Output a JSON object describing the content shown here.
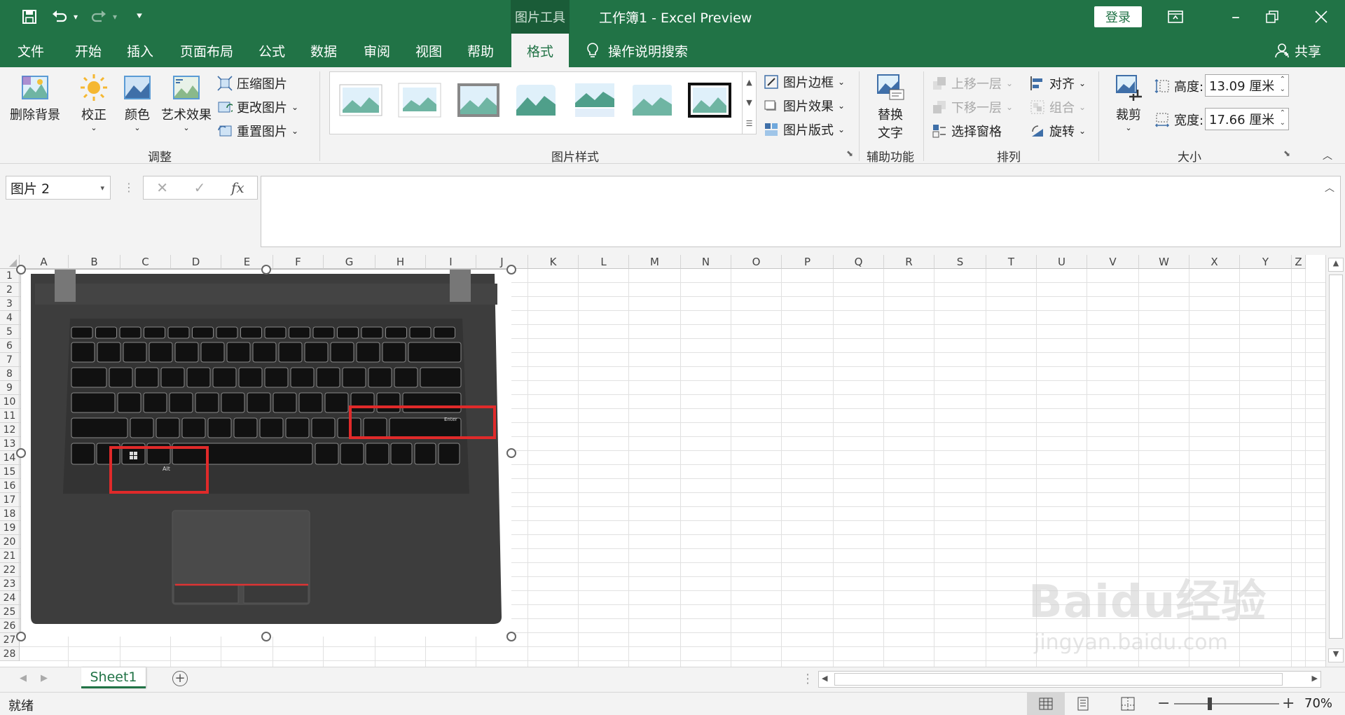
{
  "titlebar": {
    "context_label": "图片工具",
    "doc_title": "工作簿1  -  Excel Preview",
    "login": "登录",
    "minimize_icon": "ribbon-display-icon",
    "restore_icon": "restore-icon",
    "close_icon": "close-icon"
  },
  "tabs": [
    "文件",
    "开始",
    "插入",
    "页面布局",
    "公式",
    "数据",
    "审阅",
    "视图",
    "帮助",
    "格式"
  ],
  "active_tab": "格式",
  "tellme": "操作说明搜索",
  "share": "共享",
  "ribbon": {
    "adjust": {
      "remove_bg": "删除背景",
      "corrections": "校正",
      "color": "颜色",
      "artistic": "艺术效果",
      "compress": "压缩图片",
      "change": "更改图片",
      "reset": "重置图片",
      "label": "调整"
    },
    "styles": {
      "label": "图片样式",
      "border": "图片边框",
      "effects": "图片效果",
      "layout": "图片版式"
    },
    "accessibility": {
      "alt_text_line1": "替换",
      "alt_text_line2": "文字",
      "label": "辅助功能"
    },
    "arrange": {
      "bring_forward": "上移一层",
      "send_backward": "下移一层",
      "selection_pane": "选择窗格",
      "align": "对齐",
      "group": "组合",
      "rotate": "旋转",
      "label": "排列"
    },
    "size": {
      "crop": "裁剪",
      "height_label": "高度:",
      "height_value": "13.09 厘米",
      "width_label": "宽度:",
      "width_value": "17.66 厘米",
      "label": "大小"
    }
  },
  "formula_bar": {
    "name_box": "图片 2",
    "fx": "fx",
    "content": ""
  },
  "columns": [
    "A",
    "B",
    "C",
    "D",
    "E",
    "F",
    "G",
    "H",
    "I",
    "J",
    "K",
    "L",
    "M",
    "N",
    "O",
    "P",
    "Q",
    "R",
    "S",
    "T",
    "U",
    "V",
    "W",
    "X",
    "Y",
    "Z"
  ],
  "rows": [
    "1",
    "2",
    "3",
    "4",
    "5",
    "6",
    "7",
    "8",
    "9",
    "10",
    "11",
    "12",
    "13",
    "14",
    "15",
    "16",
    "17",
    "18",
    "19",
    "20",
    "21",
    "22",
    "23",
    "24",
    "25",
    "26",
    "27",
    "28"
  ],
  "sheet_tab": "Sheet1",
  "status": {
    "ready": "就绪",
    "zoom": "70%"
  },
  "watermark": {
    "brand": "Baidu经验",
    "url": "jingyan.baidu.com"
  },
  "keyboard": {
    "enter_key": "Enter",
    "alt_key": "Alt",
    "highlight_color": "#e02a2a"
  },
  "colors": {
    "accent": "#217346"
  }
}
